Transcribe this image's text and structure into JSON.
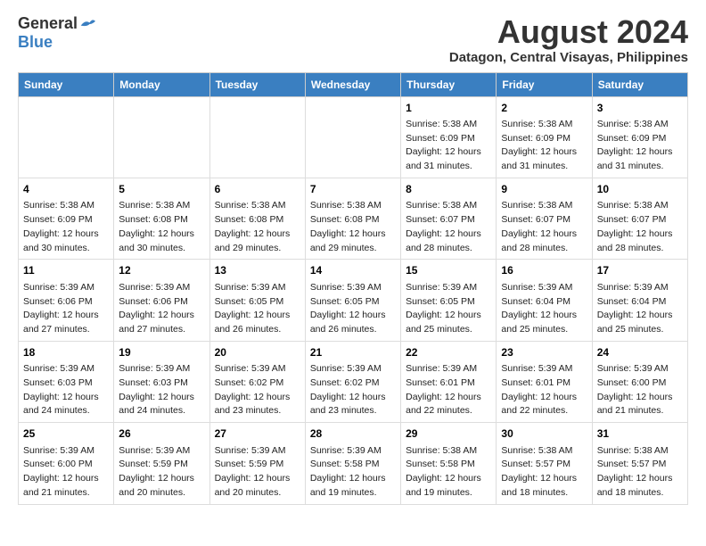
{
  "logo": {
    "general": "General",
    "blue": "Blue"
  },
  "title": "August 2024",
  "subtitle": "Datagon, Central Visayas, Philippines",
  "days_of_week": [
    "Sunday",
    "Monday",
    "Tuesday",
    "Wednesday",
    "Thursday",
    "Friday",
    "Saturday"
  ],
  "weeks": [
    [
      {
        "day": "",
        "info": ""
      },
      {
        "day": "",
        "info": ""
      },
      {
        "day": "",
        "info": ""
      },
      {
        "day": "",
        "info": ""
      },
      {
        "day": "1",
        "info": "Sunrise: 5:38 AM\nSunset: 6:09 PM\nDaylight: 12 hours\nand 31 minutes."
      },
      {
        "day": "2",
        "info": "Sunrise: 5:38 AM\nSunset: 6:09 PM\nDaylight: 12 hours\nand 31 minutes."
      },
      {
        "day": "3",
        "info": "Sunrise: 5:38 AM\nSunset: 6:09 PM\nDaylight: 12 hours\nand 31 minutes."
      }
    ],
    [
      {
        "day": "4",
        "info": "Sunrise: 5:38 AM\nSunset: 6:09 PM\nDaylight: 12 hours\nand 30 minutes."
      },
      {
        "day": "5",
        "info": "Sunrise: 5:38 AM\nSunset: 6:08 PM\nDaylight: 12 hours\nand 30 minutes."
      },
      {
        "day": "6",
        "info": "Sunrise: 5:38 AM\nSunset: 6:08 PM\nDaylight: 12 hours\nand 29 minutes."
      },
      {
        "day": "7",
        "info": "Sunrise: 5:38 AM\nSunset: 6:08 PM\nDaylight: 12 hours\nand 29 minutes."
      },
      {
        "day": "8",
        "info": "Sunrise: 5:38 AM\nSunset: 6:07 PM\nDaylight: 12 hours\nand 28 minutes."
      },
      {
        "day": "9",
        "info": "Sunrise: 5:38 AM\nSunset: 6:07 PM\nDaylight: 12 hours\nand 28 minutes."
      },
      {
        "day": "10",
        "info": "Sunrise: 5:38 AM\nSunset: 6:07 PM\nDaylight: 12 hours\nand 28 minutes."
      }
    ],
    [
      {
        "day": "11",
        "info": "Sunrise: 5:39 AM\nSunset: 6:06 PM\nDaylight: 12 hours\nand 27 minutes."
      },
      {
        "day": "12",
        "info": "Sunrise: 5:39 AM\nSunset: 6:06 PM\nDaylight: 12 hours\nand 27 minutes."
      },
      {
        "day": "13",
        "info": "Sunrise: 5:39 AM\nSunset: 6:05 PM\nDaylight: 12 hours\nand 26 minutes."
      },
      {
        "day": "14",
        "info": "Sunrise: 5:39 AM\nSunset: 6:05 PM\nDaylight: 12 hours\nand 26 minutes."
      },
      {
        "day": "15",
        "info": "Sunrise: 5:39 AM\nSunset: 6:05 PM\nDaylight: 12 hours\nand 25 minutes."
      },
      {
        "day": "16",
        "info": "Sunrise: 5:39 AM\nSunset: 6:04 PM\nDaylight: 12 hours\nand 25 minutes."
      },
      {
        "day": "17",
        "info": "Sunrise: 5:39 AM\nSunset: 6:04 PM\nDaylight: 12 hours\nand 25 minutes."
      }
    ],
    [
      {
        "day": "18",
        "info": "Sunrise: 5:39 AM\nSunset: 6:03 PM\nDaylight: 12 hours\nand 24 minutes."
      },
      {
        "day": "19",
        "info": "Sunrise: 5:39 AM\nSunset: 6:03 PM\nDaylight: 12 hours\nand 24 minutes."
      },
      {
        "day": "20",
        "info": "Sunrise: 5:39 AM\nSunset: 6:02 PM\nDaylight: 12 hours\nand 23 minutes."
      },
      {
        "day": "21",
        "info": "Sunrise: 5:39 AM\nSunset: 6:02 PM\nDaylight: 12 hours\nand 23 minutes."
      },
      {
        "day": "22",
        "info": "Sunrise: 5:39 AM\nSunset: 6:01 PM\nDaylight: 12 hours\nand 22 minutes."
      },
      {
        "day": "23",
        "info": "Sunrise: 5:39 AM\nSunset: 6:01 PM\nDaylight: 12 hours\nand 22 minutes."
      },
      {
        "day": "24",
        "info": "Sunrise: 5:39 AM\nSunset: 6:00 PM\nDaylight: 12 hours\nand 21 minutes."
      }
    ],
    [
      {
        "day": "25",
        "info": "Sunrise: 5:39 AM\nSunset: 6:00 PM\nDaylight: 12 hours\nand 21 minutes."
      },
      {
        "day": "26",
        "info": "Sunrise: 5:39 AM\nSunset: 5:59 PM\nDaylight: 12 hours\nand 20 minutes."
      },
      {
        "day": "27",
        "info": "Sunrise: 5:39 AM\nSunset: 5:59 PM\nDaylight: 12 hours\nand 20 minutes."
      },
      {
        "day": "28",
        "info": "Sunrise: 5:39 AM\nSunset: 5:58 PM\nDaylight: 12 hours\nand 19 minutes."
      },
      {
        "day": "29",
        "info": "Sunrise: 5:38 AM\nSunset: 5:58 PM\nDaylight: 12 hours\nand 19 minutes."
      },
      {
        "day": "30",
        "info": "Sunrise: 5:38 AM\nSunset: 5:57 PM\nDaylight: 12 hours\nand 18 minutes."
      },
      {
        "day": "31",
        "info": "Sunrise: 5:38 AM\nSunset: 5:57 PM\nDaylight: 12 hours\nand 18 minutes."
      }
    ]
  ]
}
